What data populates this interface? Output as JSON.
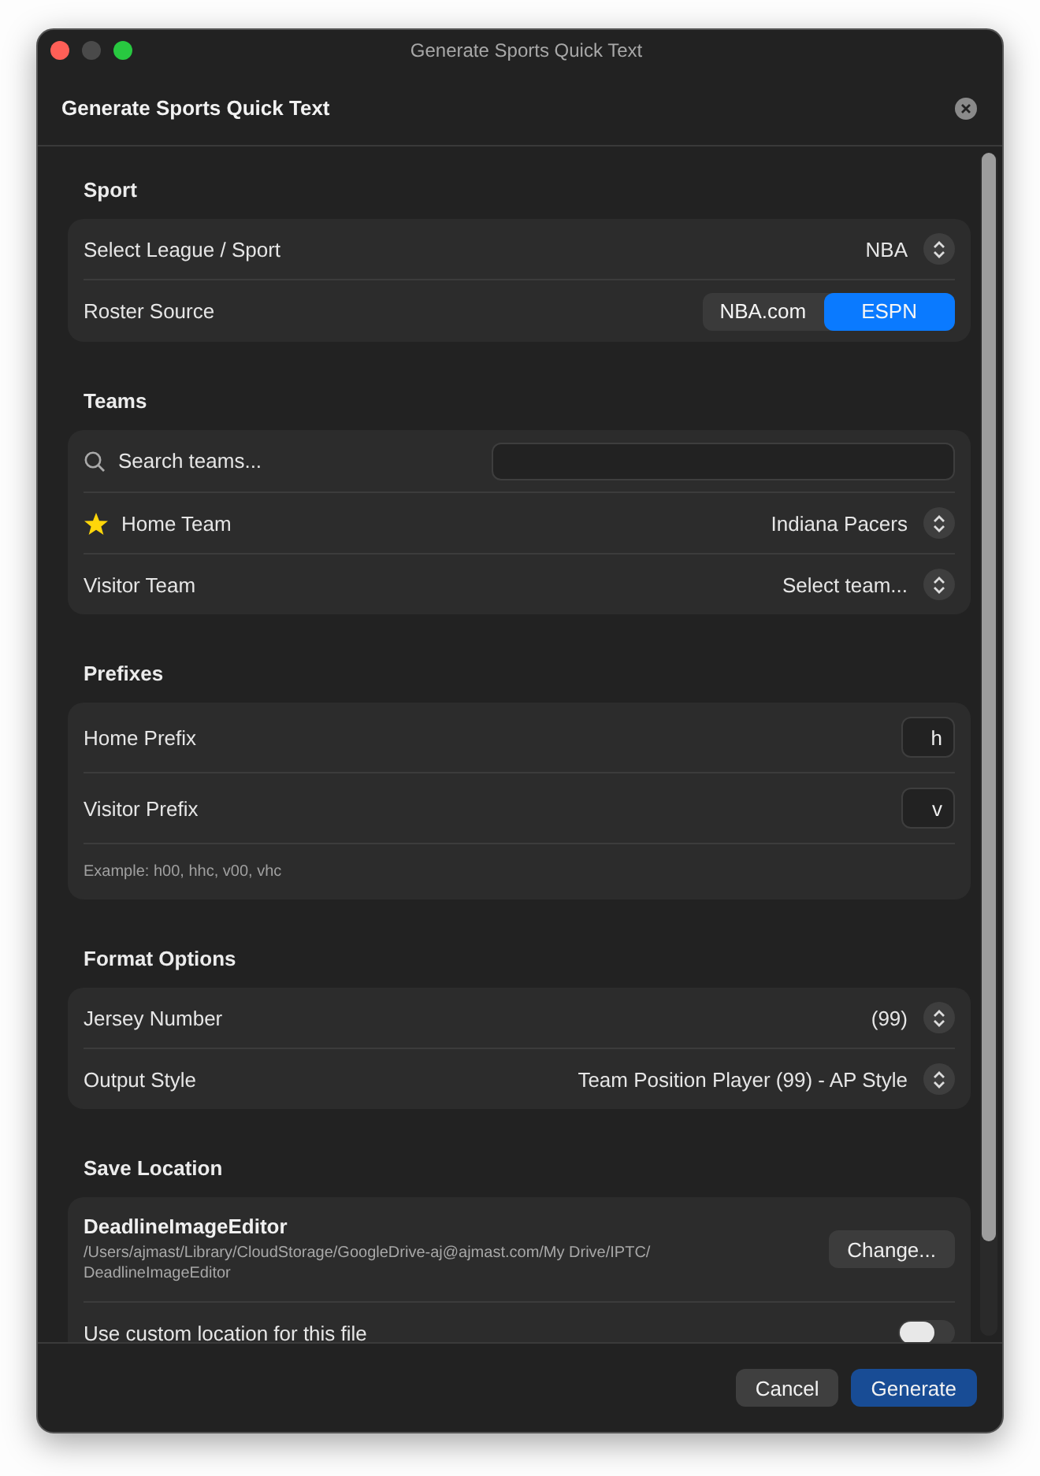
{
  "window": {
    "title": "Generate Sports Quick Text"
  },
  "dialog": {
    "title": "Generate Sports Quick Text"
  },
  "sections": [
    {
      "heading": "Sport",
      "rows": [
        {
          "kind": "popup",
          "label": "Select League / Sport",
          "value": "NBA",
          "starred": false
        },
        {
          "kind": "segmented",
          "label": "Roster Source",
          "options": [
            {
              "label": "NBA.com",
              "selected": false
            },
            {
              "label": "ESPN",
              "selected": true
            }
          ]
        }
      ]
    },
    {
      "heading": "Teams",
      "rows": [
        {
          "kind": "search",
          "label": "Search teams..."
        },
        {
          "kind": "popup",
          "label": "Home Team",
          "value": "Indiana Pacers",
          "starred": true
        },
        {
          "kind": "popup",
          "label": "Visitor Team",
          "value": "Select team...",
          "starred": false
        }
      ]
    },
    {
      "heading": "Prefixes",
      "rows": [
        {
          "kind": "text-field",
          "label": "Home Prefix",
          "value": "h"
        },
        {
          "kind": "text-field",
          "label": "Visitor Prefix",
          "value": "v"
        },
        {
          "kind": "note",
          "text": "Example: h00, hhc, v00, vhc"
        }
      ]
    },
    {
      "heading": "Format Options",
      "rows": [
        {
          "kind": "popup",
          "label": "Jersey Number",
          "value": "(99)",
          "starred": false
        },
        {
          "kind": "popup",
          "label": "Output Style",
          "value": "Team Position Player (99) - AP Style",
          "starred": false
        }
      ]
    },
    {
      "heading": "Save Location",
      "rows": [
        {
          "kind": "location",
          "name": "DeadlineImageEditor",
          "path": "/Users/ajmast/Library/CloudStorage/GoogleDrive-aj@ajmast.com/My Drive/IPTC/ DeadlineImageEditor",
          "button": "Change..."
        },
        {
          "kind": "toggle",
          "label": "Use custom location for this file",
          "on": false
        }
      ]
    }
  ],
  "footer": {
    "buttons": [
      {
        "label": "Cancel",
        "kind": "secondary"
      },
      {
        "label": "Generate",
        "kind": "primary"
      }
    ]
  }
}
